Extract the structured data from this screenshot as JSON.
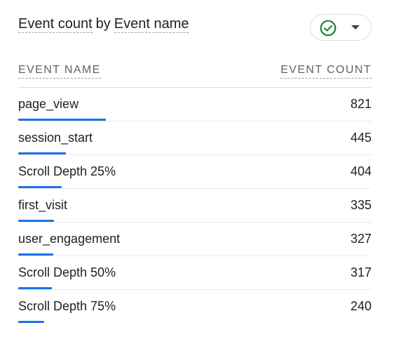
{
  "card": {
    "title_part1": "Event count",
    "title_by": "by",
    "title_part2": "Event name",
    "status_icon": "check-circle-icon",
    "status_color": "#188038",
    "dropdown_icon": "caret-down-icon"
  },
  "table": {
    "col_name": "EVENT NAME",
    "col_count": "EVENT COUNT",
    "bar_color": "#1a73e8",
    "max_count": 821,
    "rows": [
      {
        "name": "page_view",
        "count": "821",
        "value": 821
      },
      {
        "name": "session_start",
        "count": "445",
        "value": 445
      },
      {
        "name": "Scroll Depth 25%",
        "count": "404",
        "value": 404
      },
      {
        "name": "first_visit",
        "count": "335",
        "value": 335
      },
      {
        "name": "user_engagement",
        "count": "327",
        "value": 327
      },
      {
        "name": "Scroll Depth 50%",
        "count": "317",
        "value": 317
      },
      {
        "name": "Scroll Depth 75%",
        "count": "240",
        "value": 240
      }
    ]
  }
}
